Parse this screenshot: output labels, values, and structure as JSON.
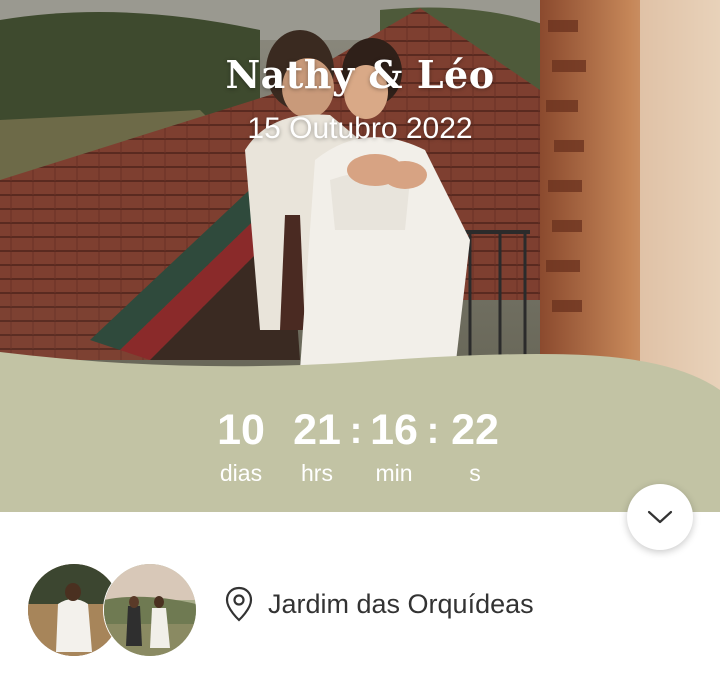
{
  "event": {
    "title": "Nathy & Léo",
    "date": "15 Outubro 2022"
  },
  "countdown": {
    "days": {
      "value": "10",
      "label": "dias"
    },
    "hours": {
      "value": "21",
      "label": "hrs"
    },
    "minutes": {
      "value": "16",
      "label": "min"
    },
    "seconds": {
      "value": "22",
      "label": "s"
    },
    "separator": ":"
  },
  "venue": {
    "name": "Jardim das Orquídeas",
    "icon": "location-pin-icon"
  },
  "scroll_button": {
    "icon": "chevron-down-icon"
  },
  "colors": {
    "band": "#c2c3a4",
    "text_white": "#ffffff",
    "venue_text": "#333333"
  }
}
